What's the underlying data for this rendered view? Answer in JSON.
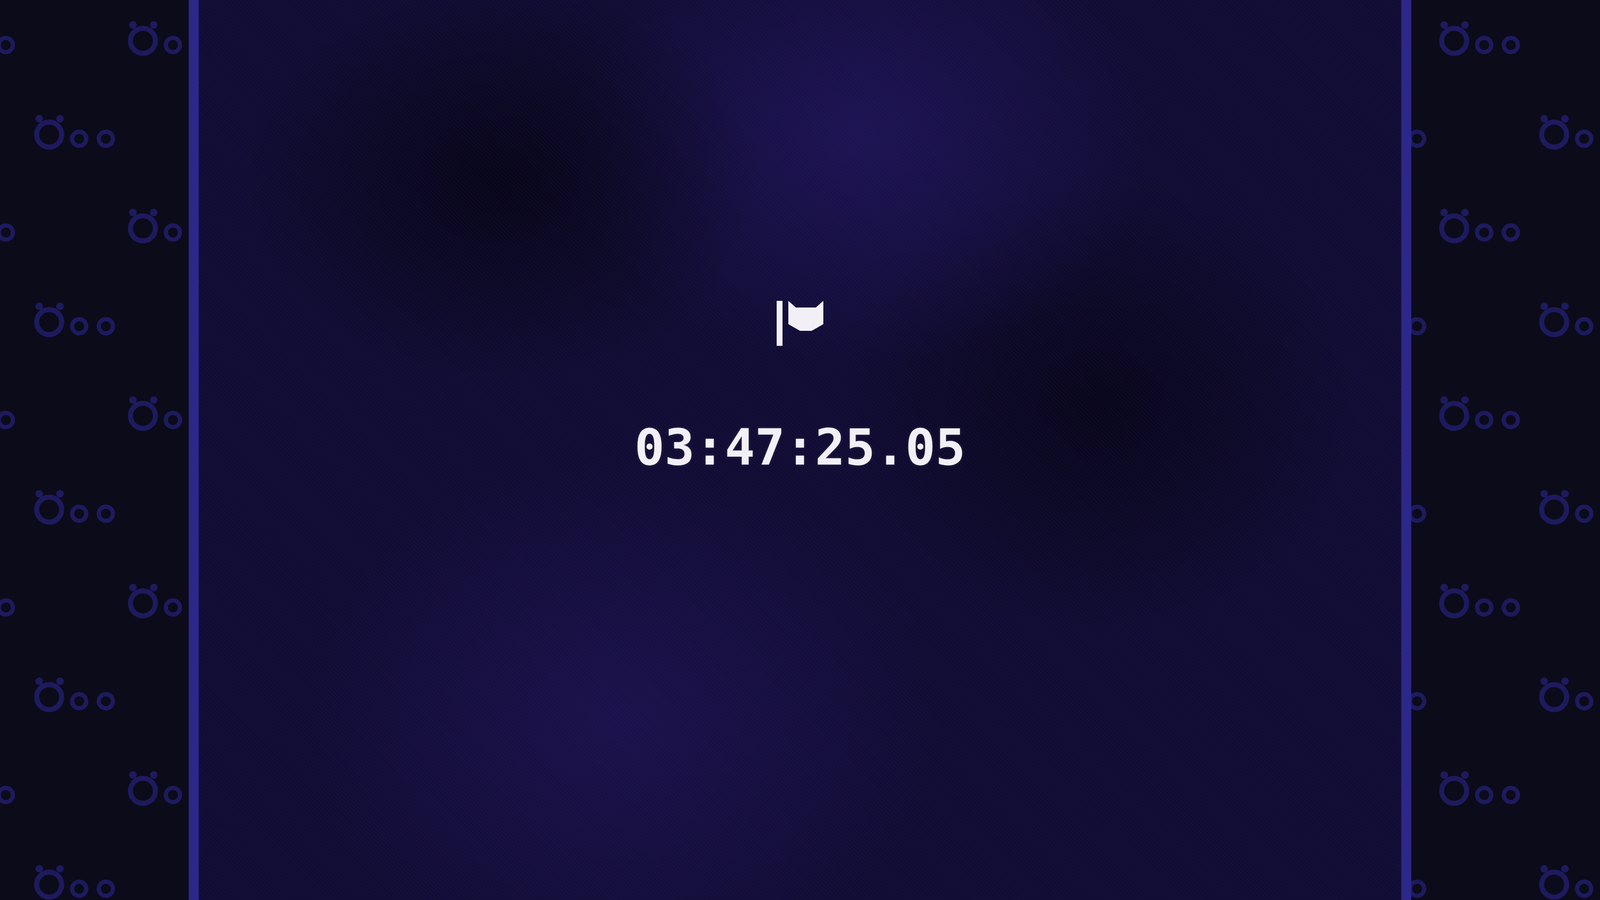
{
  "timer": {
    "time": "03:47:25.05"
  }
}
